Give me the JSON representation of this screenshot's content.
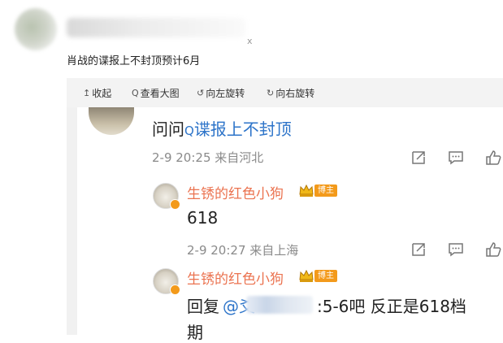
{
  "post": {
    "meta_tail": "x",
    "text": "肖战的谍报上不封顶预计6月"
  },
  "toolbar": {
    "collapse": "收起",
    "view_large": "查看大图",
    "rotate_left": "向左旋转",
    "rotate_right": "向右旋转",
    "collapse_icon": "↥",
    "view_large_icon": "Q",
    "rotate_left_icon": "↺",
    "rotate_right_icon": "↻"
  },
  "comments": [
    {
      "prefix": "问问",
      "link_icon": "Q",
      "link_text": "谍报上不封顶",
      "time": "2-9 20:25",
      "source": "来自河北"
    },
    {
      "user": "生锈的红色小狗",
      "badge": "博主",
      "text": "618",
      "time": "2-9 20:27",
      "source": "来自上海"
    },
    {
      "user": "生锈的红色小狗",
      "badge": "博主",
      "reply_prefix": "回复",
      "mention_at": "@",
      "mention_partial": "爻",
      "text_after": ":5-6吧 反正是618档",
      "text_line2": "期"
    }
  ],
  "colors": {
    "username": "#eb7350",
    "link": "#2d74c9",
    "badge": "#f39a1b"
  }
}
